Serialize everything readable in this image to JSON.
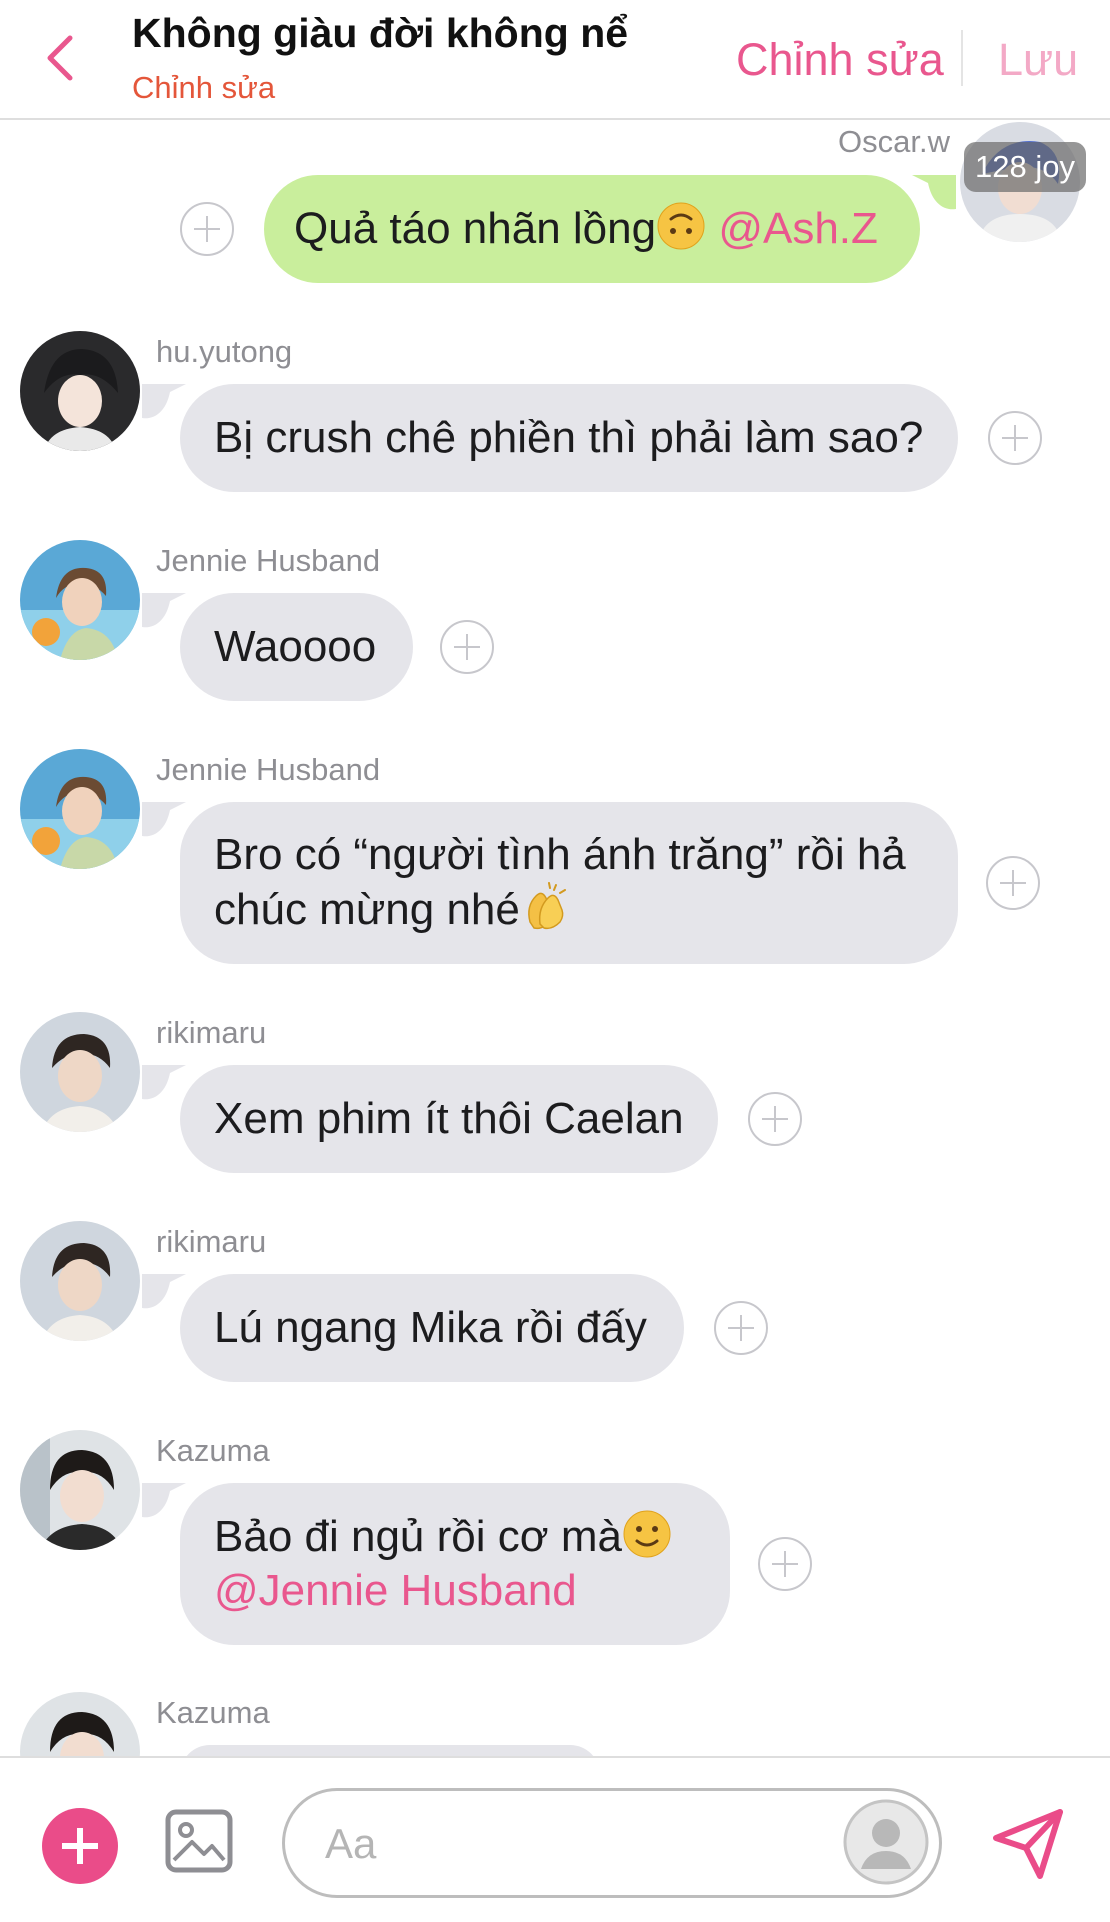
{
  "header": {
    "title": "Không giàu đời không nể",
    "subtitle": "Chỉnh sửa",
    "edit_label": "Chỉnh sửa",
    "save_label": "Lưu"
  },
  "my_message": {
    "sender": "Oscar.w",
    "joy": "128 joy",
    "text": "Quả táo nhãn lồng",
    "emoji": "upside-down-face",
    "mention": "@Ash.Z"
  },
  "messages": [
    {
      "sender": "hu.yutong",
      "text": "Bị crush chê phiền thì phải làm sao?"
    },
    {
      "sender": "Jennie Husband",
      "text": "Waoooo"
    },
    {
      "sender": "Jennie Husband",
      "line1": "Bro có “người tình ánh trăng” rồi hả",
      "line2": "chúc mừng nhé",
      "emoji": "clapping-hands"
    },
    {
      "sender": "rikimaru",
      "text": "Xem phim ít thôi Caelan"
    },
    {
      "sender": "rikimaru",
      "text": "Lú ngang Mika rồi đấy"
    },
    {
      "sender": "Kazuma",
      "text": "Bảo đi ngủ rồi cơ mà",
      "emoji": "slightly-smiling-face",
      "mention": "@Jennie Husband"
    },
    {
      "sender": "Kazuma"
    }
  ],
  "composer": {
    "placeholder": "Aa"
  },
  "colors": {
    "accent": "#e9578e",
    "subtitle": "#e4563a",
    "incoming_bubble": "#e5e5ea",
    "outgoing_bubble": "#c9ee9c",
    "add_button": "#ea4c89"
  }
}
